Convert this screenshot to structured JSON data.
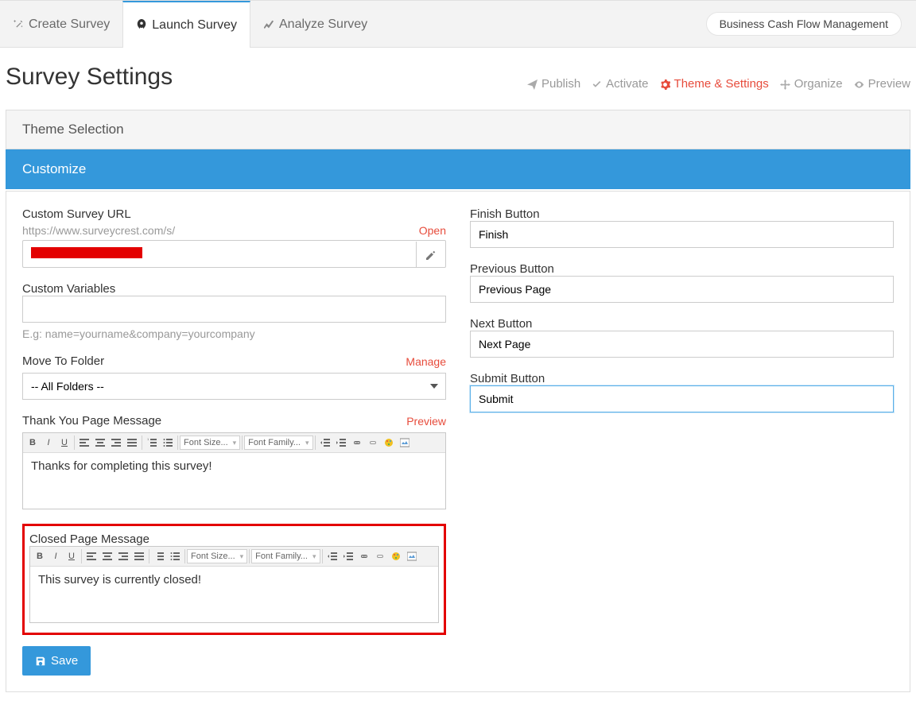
{
  "brand_pill": "Business Cash Flow Management",
  "topnav": {
    "create": "Create Survey",
    "launch": "Launch Survey",
    "analyze": "Analyze Survey"
  },
  "page_title": "Survey Settings",
  "actions": {
    "publish": "Publish",
    "activate": "Activate",
    "theme": "Theme & Settings",
    "organize": "Organize",
    "preview": "Preview"
  },
  "panels": {
    "theme_selection": "Theme Selection",
    "customize": "Customize"
  },
  "left": {
    "custom_url_label": "Custom Survey URL",
    "custom_url_prefix": "https://www.surveycrest.com/s/",
    "open": "Open",
    "custom_url_value": "",
    "custom_vars_label": "Custom Variables",
    "custom_vars_value": "",
    "custom_vars_hint": "E.g: name=yourname&company=yourcompany",
    "move_label": "Move To Folder",
    "manage": "Manage",
    "move_value": "-- All Folders --",
    "thankyou_label": "Thank You Page Message",
    "preview": "Preview",
    "thankyou_text": "Thanks for completing this survey!",
    "closed_label": "Closed Page Message",
    "closed_text": "This survey is currently closed!"
  },
  "right": {
    "finish_label": "Finish Button",
    "finish_value": "Finish",
    "prev_label": "Previous Button",
    "prev_value": "Previous Page",
    "next_label": "Next Button",
    "next_value": "Next Page",
    "submit_label": "Submit Button",
    "submit_value": "Submit"
  },
  "editor": {
    "font_size": "Font Size...",
    "font_family": "Font Family..."
  },
  "save": "Save",
  "icons": {
    "bold": "B",
    "italic": "I",
    "underline": "U"
  }
}
